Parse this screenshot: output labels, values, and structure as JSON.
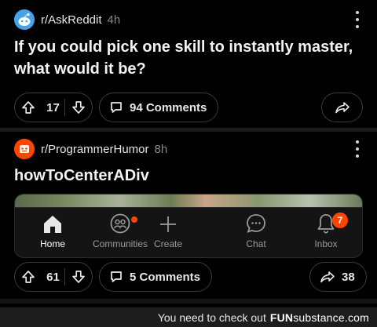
{
  "posts": [
    {
      "subreddit": "r/AskReddit",
      "age": "4h",
      "title": "If you could pick one skill to instantly master, what would it be?",
      "votes": "17",
      "comments": "94 Comments"
    },
    {
      "subreddit": "r/ProgrammerHumor",
      "age": "8h",
      "title": "howToCenterADiv",
      "votes": "61",
      "comments": "5 Comments",
      "shares": "38"
    }
  ],
  "embedded_nav": {
    "items": [
      {
        "label": "Home",
        "icon": "home-icon"
      },
      {
        "label": "Communities",
        "icon": "communities-icon"
      },
      {
        "label": "Create",
        "icon": "plus-icon"
      },
      {
        "label": "Chat",
        "icon": "chat-icon"
      },
      {
        "label": "Inbox",
        "icon": "bell-icon"
      }
    ],
    "inbox_badge": "7"
  },
  "footer": {
    "message": "You need to check out",
    "brand_fun": "FUN",
    "brand_rest": "substance",
    "brand_tld": ".com"
  },
  "colors": {
    "accent": "#ff4500",
    "background": "#000000"
  }
}
